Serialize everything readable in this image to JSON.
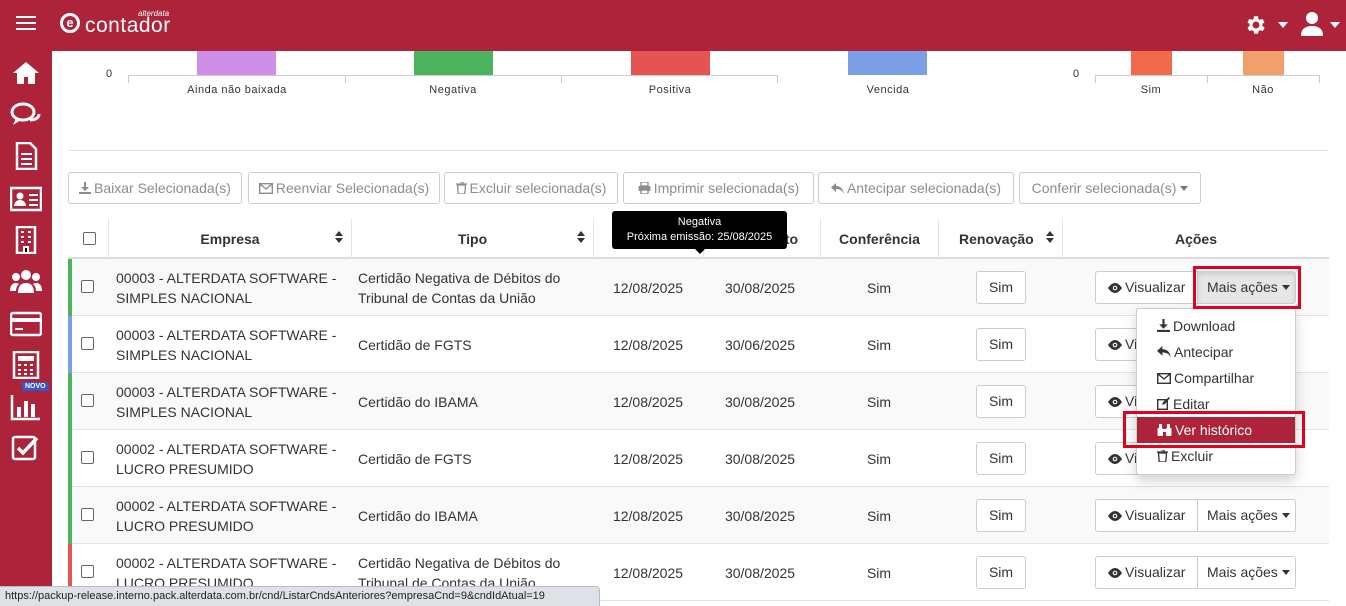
{
  "app": {
    "logo_text": "contador",
    "logo_sub": "alterdata",
    "logo_mark": "e"
  },
  "colors": {
    "brand": "#ad233a",
    "green": "#4cb35e",
    "blue": "#7b9fe6",
    "red": "#e45452",
    "menu_highlight": "#ad233a",
    "annotation_box": "#e3001b"
  },
  "sidebar": {
    "items": [
      {
        "icon": "home-icon"
      },
      {
        "icon": "chat-icon"
      },
      {
        "icon": "document-icon"
      },
      {
        "icon": "id-card-icon"
      },
      {
        "icon": "building-icon"
      },
      {
        "icon": "users-icon"
      },
      {
        "icon": "credit-card-icon"
      },
      {
        "icon": "calculator-icon"
      },
      {
        "icon": "bar-chart-icon",
        "badge": "NOVO"
      },
      {
        "icon": "checkbox-icon"
      }
    ]
  },
  "chart_data": [
    {
      "type": "bar",
      "categories": [
        "Ainda não baixada",
        "Negativa",
        "Positiva",
        "Vencida"
      ],
      "colors": [
        "#cf8fe8",
        "#4cb35e",
        "#e45452",
        "#7b9fe6"
      ],
      "ytick_visible": "0"
    },
    {
      "type": "bar",
      "categories": [
        "Sim",
        "Não"
      ],
      "colors": [
        "#f26a4b",
        "#f2a06b"
      ],
      "ytick_visible": "0"
    }
  ],
  "toolbar": {
    "baixar": "Baixar Selecionada(s)",
    "reenviar": "Reenviar Selecionada(s)",
    "excluir": "Excluir selecionada(s)",
    "imprimir": "Imprimir selecionada(s)",
    "antecipar": "Antecipar selecionada(s)",
    "conferir": "Conferir selecionada(s)"
  },
  "table": {
    "headers": {
      "empresa": "Empresa",
      "tipo": "Tipo",
      "vencimento_tail": "to",
      "conferencia": "Conferência",
      "renovacao": "Renovação",
      "acoes": "Ações"
    },
    "rows": [
      {
        "empresa_1": "00003 - ALTERDATA SOFTWARE -",
        "empresa_2": "SIMPLES NACIONAL",
        "tipo_1": "Certidão Negativa de Débitos do",
        "tipo_2": "Tribunal de Contas da União",
        "emissao": "12/08/2025",
        "vencimento": "30/08/2025",
        "conferencia": "Sim",
        "renovacao": "Sim",
        "status_color": "#4cb35e"
      },
      {
        "empresa_1": "00003 - ALTERDATA SOFTWARE -",
        "empresa_2": "SIMPLES NACIONAL",
        "tipo_1": "Certidão de FGTS",
        "tipo_2": "",
        "emissao": "12/08/2025",
        "vencimento": "30/06/2025",
        "conferencia": "Sim",
        "renovacao": "Sim",
        "status_color": "#7b9fe6"
      },
      {
        "empresa_1": "00003 - ALTERDATA SOFTWARE -",
        "empresa_2": "SIMPLES NACIONAL",
        "tipo_1": "Certidão do IBAMA",
        "tipo_2": "",
        "emissao": "12/08/2025",
        "vencimento": "30/08/2025",
        "conferencia": "Sim",
        "renovacao": "Sim",
        "status_color": "#4cb35e"
      },
      {
        "empresa_1": "00002 - ALTERDATA SOFTWARE -",
        "empresa_2": "LUCRO PRESUMIDO",
        "tipo_1": "Certidão de FGTS",
        "tipo_2": "",
        "emissao": "12/08/2025",
        "vencimento": "30/08/2025",
        "conferencia": "Sim",
        "renovacao": "Sim",
        "status_color": "#4cb35e"
      },
      {
        "empresa_1": "00002 - ALTERDATA SOFTWARE -",
        "empresa_2": "LUCRO PRESUMIDO",
        "tipo_1": "Certidão do IBAMA",
        "tipo_2": "",
        "emissao": "12/08/2025",
        "vencimento": "30/08/2025",
        "conferencia": "Sim",
        "renovacao": "Sim",
        "status_color": "#4cb35e"
      },
      {
        "empresa_1": "00002 - ALTERDATA SOFTWARE -",
        "empresa_2": "LUCRO PRESUMIDO",
        "tipo_1": "Certidão Negativa de Débitos do",
        "tipo_2": "Tribunal de Contas da União",
        "emissao": "12/08/2025",
        "vencimento": "30/08/2025",
        "conferencia": "Sim",
        "renovacao": "Sim",
        "status_color": "#e45452"
      }
    ],
    "visualizar": "Visualizar",
    "mais_acoes": "Mais ações"
  },
  "tooltip": {
    "line1": "Negativa",
    "line2": "Próxima emissão: 25/08/2025"
  },
  "dropdown": {
    "items": [
      {
        "label": "Download",
        "icon": "download-icon"
      },
      {
        "label": "Antecipar",
        "icon": "reply-icon"
      },
      {
        "label": "Compartilhar",
        "icon": "envelope-icon"
      },
      {
        "label": "Editar",
        "icon": "edit-icon"
      },
      {
        "label": "Ver histórico",
        "icon": "binoculars-icon",
        "active": true
      },
      {
        "label": "Excluir",
        "icon": "trash-icon"
      }
    ]
  },
  "statusbar": {
    "url": "https://packup-release.interno.pack.alterdata.com.br/cnd/ListarCndsAnteriores?empresaCnd=9&cndIdAtual=19"
  }
}
